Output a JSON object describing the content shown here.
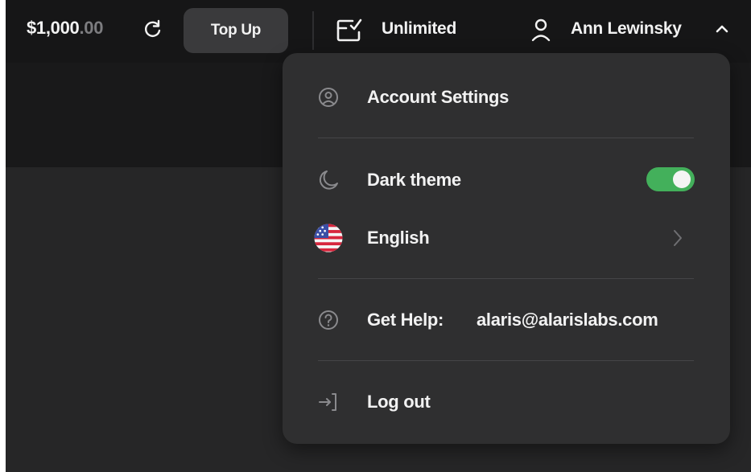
{
  "header": {
    "balance_main": "$1,000",
    "balance_cents": ".00",
    "topup_label": "Top Up",
    "plan_label": "Unlimited",
    "user_name": "Ann Lewinsky"
  },
  "menu": {
    "account_settings": "Account Settings",
    "dark_theme": "Dark theme",
    "dark_theme_on": true,
    "language": "English",
    "help_label": "Get Help:",
    "help_email": "alaris@alarislabs.com",
    "logout": "Log out"
  },
  "colors": {
    "toggle_on": "#43b05b",
    "menu_bg": "#2f2f30",
    "topbar_bg": "#161617"
  },
  "icons": [
    "refresh-icon",
    "plan-icon",
    "user-icon",
    "chevron-up-icon",
    "account-icon",
    "moon-icon",
    "us-flag-icon",
    "chevron-right-icon",
    "help-icon",
    "logout-icon"
  ]
}
